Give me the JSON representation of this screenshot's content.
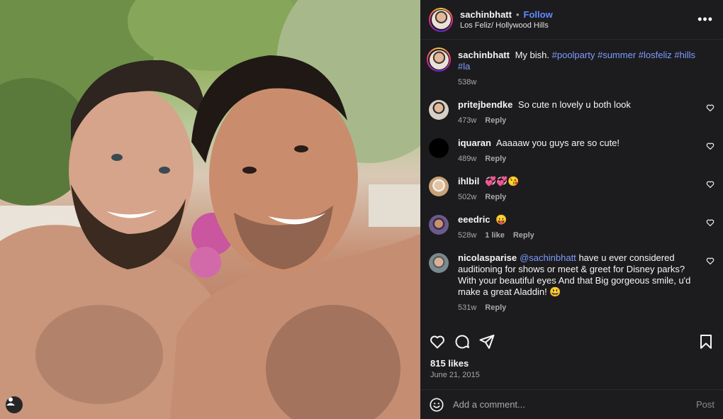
{
  "header": {
    "username": "sachinbhatt",
    "dot": "•",
    "follow_label": "Follow",
    "location": "Los Feliz/ Hollywood Hills",
    "more_label": "•••"
  },
  "caption": {
    "username": "sachinbhatt",
    "text": "My bish.",
    "hashtags": [
      "#poolparty",
      "#summer",
      "#losfeliz",
      "#hills",
      "#la"
    ],
    "time": "538w"
  },
  "comments": [
    {
      "username": "pritejbendke",
      "text": "So cute n lovely u both look",
      "time": "473w",
      "likes": "",
      "reply": "Reply",
      "avatar_color": "#d8cfc4"
    },
    {
      "username": "iquaran",
      "text": "Aaaaaw you guys are so cute!",
      "time": "489w",
      "likes": "",
      "reply": "Reply",
      "avatar_color": "#000000"
    },
    {
      "username": "ihlbil",
      "text": "💞💞😘",
      "time": "502w",
      "likes": "",
      "reply": "Reply",
      "avatar_color": "#c9a27a"
    },
    {
      "username": "eeedric",
      "text": "😛",
      "time": "528w",
      "likes": "1 like",
      "reply": "Reply",
      "avatar_color": "#6b5a8a"
    },
    {
      "username": "nicolasparise",
      "mention": "@sachinbhatt",
      "text": "have u ever considered auditioning for shows or meet & greet for Disney parks? With your beautiful eyes And that Big gorgeous smile, u'd make a great Aladdin! 😃",
      "time": "531w",
      "likes": "",
      "reply": "Reply",
      "avatar_color": "#7a8a8e"
    }
  ],
  "stats": {
    "likes": "815 likes",
    "date": "June 21, 2015"
  },
  "composer": {
    "placeholder": "Add a comment...",
    "post_label": "Post"
  },
  "icons": [
    "heart-icon",
    "comment-icon",
    "share-icon",
    "bookmark-icon",
    "emoji-icon",
    "user-tag-icon",
    "more-icon"
  ]
}
